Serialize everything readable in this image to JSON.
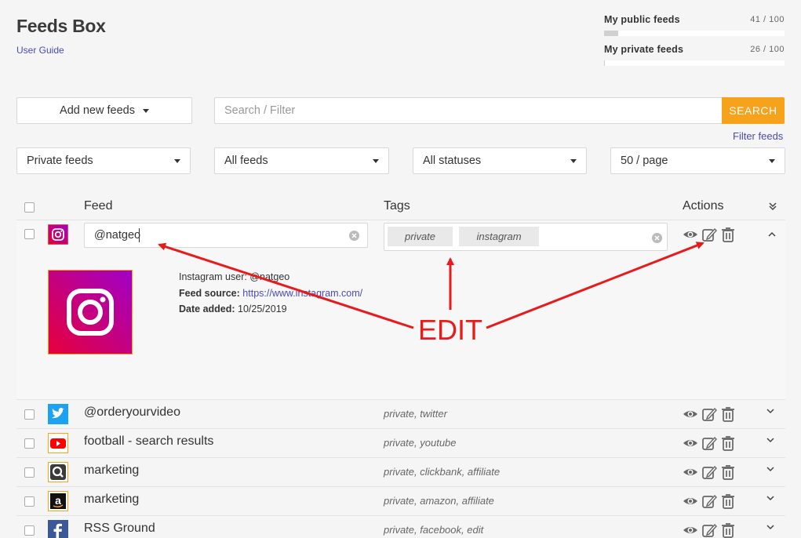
{
  "page": {
    "title": "Feeds Box",
    "user_guide": "User Guide"
  },
  "quotas": [
    {
      "label": "My public feeds",
      "count": "41 / 100",
      "fraction": 0.41
    },
    {
      "label": "My private feeds",
      "count": "26 / 100",
      "fraction": 0.26
    }
  ],
  "toolbar": {
    "add_new": "Add new feeds",
    "search_placeholder": "Search / Filter",
    "search_button": "SEARCH",
    "filter_feeds": "Filter feeds"
  },
  "filters": {
    "visibility": "Private feeds",
    "type": "All feeds",
    "status": "All statuses",
    "per_page": "50 / page"
  },
  "table": {
    "col_feed": "Feed",
    "col_tags": "Tags",
    "col_actions": "Actions"
  },
  "expanded_row": {
    "feed_value": "@natgeo",
    "tags": [
      "private",
      "instagram"
    ],
    "instagram_user_label": "Instagram user: @natgeo",
    "feed_source_label": "Feed source:",
    "feed_source_url": "https://www.instagram.com/",
    "date_added_label": "Date added:",
    "date_added": "10/25/2019"
  },
  "rows": [
    {
      "name": "@orderyourvideo",
      "tags": "private, twitter",
      "icon": "twitter-icon",
      "color": "#1da1f2"
    },
    {
      "name": "football - search results",
      "tags": "private, youtube",
      "icon": "youtube-icon",
      "color": "#ff0000"
    },
    {
      "name": "marketing",
      "tags": "private, clickbank, affiliate",
      "icon": "clickbank-icon",
      "color": "#333333"
    },
    {
      "name": "marketing",
      "tags": "private, amazon, affiliate",
      "icon": "amazon-icon",
      "color": "#111111"
    },
    {
      "name": "RSS Ground",
      "tags": "private, facebook, edit",
      "icon": "facebook-icon",
      "color": "#3b5998"
    }
  ],
  "annotation": {
    "label": "EDIT",
    "color": "#e81a1a"
  },
  "colors": {
    "accent": "#f7a21b",
    "link": "#4a4ab5"
  }
}
